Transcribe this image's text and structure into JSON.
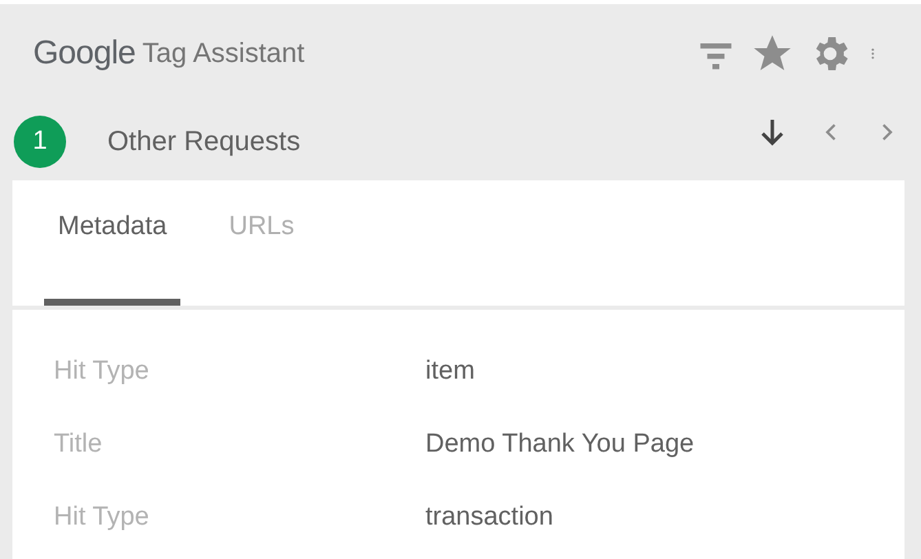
{
  "header": {
    "brand": "Google",
    "title": "Tag Assistant"
  },
  "request": {
    "count": "1",
    "title": "Other Requests"
  },
  "tabs": [
    {
      "label": "Metadata",
      "selected": true
    },
    {
      "label": "URLs",
      "selected": false
    }
  ],
  "rows": [
    {
      "label": "Hit Type",
      "value": "item"
    },
    {
      "label": "Title",
      "value": "Demo Thank You Page"
    },
    {
      "label": "Hit Type",
      "value": "transaction"
    }
  ]
}
